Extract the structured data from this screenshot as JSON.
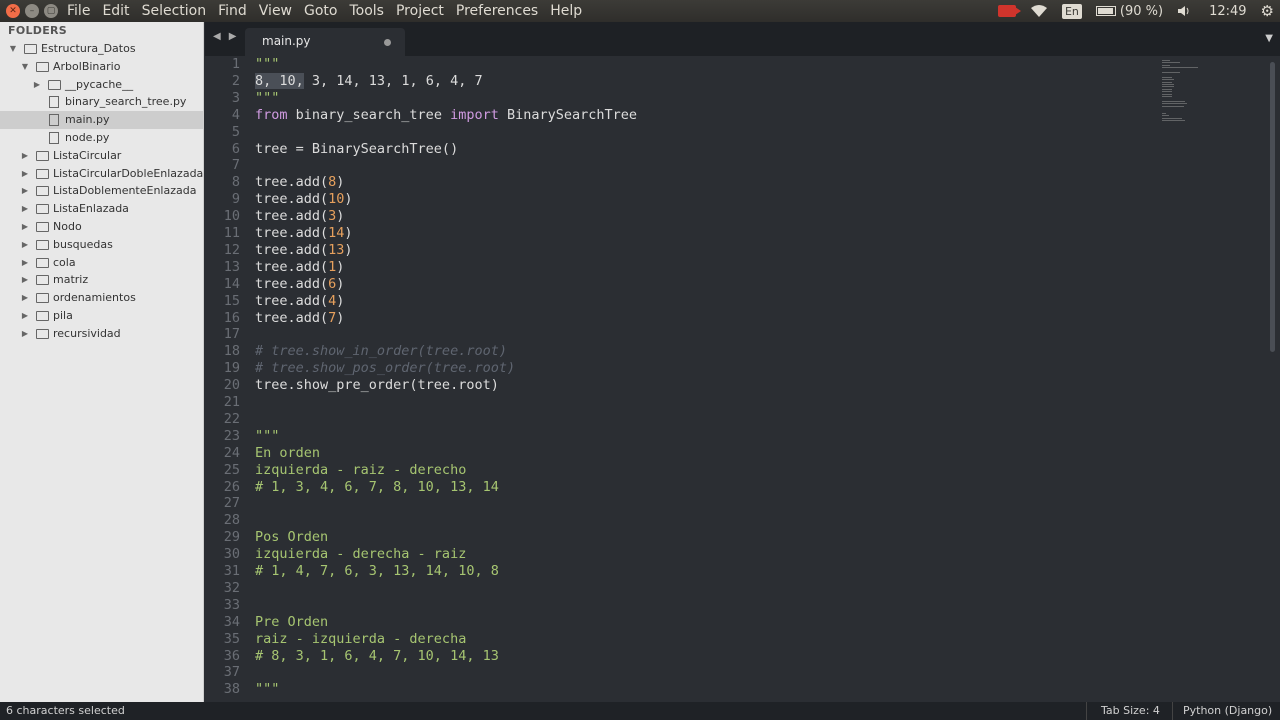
{
  "menubar": {
    "menus": [
      "File",
      "Edit",
      "Selection",
      "Find",
      "View",
      "Goto",
      "Tools",
      "Project",
      "Preferences",
      "Help"
    ],
    "keyboard_layout": "En",
    "battery": "(90 %)",
    "clock": "12:49"
  },
  "sidebar": {
    "title": "FOLDERS",
    "items": [
      {
        "label": "Estructura_Datos",
        "type": "folder",
        "level": 0,
        "expanded": true,
        "selected": false
      },
      {
        "label": "ArbolBinario",
        "type": "folder",
        "level": 1,
        "expanded": true,
        "selected": false
      },
      {
        "label": "__pycache__",
        "type": "folder",
        "level": 2,
        "expanded": false,
        "selected": false
      },
      {
        "label": "binary_search_tree.py",
        "type": "file",
        "level": 2,
        "selected": false
      },
      {
        "label": "main.py",
        "type": "file",
        "level": 2,
        "selected": true
      },
      {
        "label": "node.py",
        "type": "file",
        "level": 2,
        "selected": false
      },
      {
        "label": "ListaCircular",
        "type": "folder",
        "level": 1,
        "expanded": false,
        "selected": false
      },
      {
        "label": "ListaCircularDobleEnlazada",
        "type": "folder",
        "level": 1,
        "expanded": false,
        "selected": false
      },
      {
        "label": "ListaDoblementeEnlazada",
        "type": "folder",
        "level": 1,
        "expanded": false,
        "selected": false
      },
      {
        "label": "ListaEnlazada",
        "type": "folder",
        "level": 1,
        "expanded": false,
        "selected": false
      },
      {
        "label": "Nodo",
        "type": "folder",
        "level": 1,
        "expanded": false,
        "selected": false
      },
      {
        "label": "busquedas",
        "type": "folder",
        "level": 1,
        "expanded": false,
        "selected": false
      },
      {
        "label": "cola",
        "type": "folder",
        "level": 1,
        "expanded": false,
        "selected": false
      },
      {
        "label": "matriz",
        "type": "folder",
        "level": 1,
        "expanded": false,
        "selected": false
      },
      {
        "label": "ordenamientos",
        "type": "folder",
        "level": 1,
        "expanded": false,
        "selected": false
      },
      {
        "label": "pila",
        "type": "folder",
        "level": 1,
        "expanded": false,
        "selected": false
      },
      {
        "label": "recursividad",
        "type": "folder",
        "level": 1,
        "expanded": false,
        "selected": false
      }
    ]
  },
  "tabs": [
    {
      "label": "main.py",
      "active": true,
      "modified": true
    }
  ],
  "editor": {
    "lines": [
      {
        "n": "1",
        "tokens": [
          [
            "str",
            "\"\"\""
          ]
        ]
      },
      {
        "n": "2",
        "tokens": [
          [
            "sel",
            "8, 10,"
          ],
          [
            "plain",
            " 3, 14, 13, 1, 6, 4, 7"
          ]
        ]
      },
      {
        "n": "3",
        "tokens": [
          [
            "str",
            "\"\"\""
          ]
        ]
      },
      {
        "n": "4",
        "tokens": [
          [
            "kw",
            "from"
          ],
          [
            "plain",
            " binary_search_tree "
          ],
          [
            "kw",
            "import"
          ],
          [
            "plain",
            " BinarySearchTree"
          ]
        ]
      },
      {
        "n": "5",
        "tokens": []
      },
      {
        "n": "6",
        "tokens": [
          [
            "plain",
            "tree = BinarySearchTree()"
          ]
        ]
      },
      {
        "n": "7",
        "tokens": []
      },
      {
        "n": "8",
        "tokens": [
          [
            "plain",
            "tree.add("
          ],
          [
            "num",
            "8"
          ],
          [
            "plain",
            ")"
          ]
        ]
      },
      {
        "n": "9",
        "tokens": [
          [
            "plain",
            "tree.add("
          ],
          [
            "num",
            "10"
          ],
          [
            "plain",
            ")"
          ]
        ]
      },
      {
        "n": "10",
        "tokens": [
          [
            "plain",
            "tree.add("
          ],
          [
            "num",
            "3"
          ],
          [
            "plain",
            ")"
          ]
        ]
      },
      {
        "n": "11",
        "tokens": [
          [
            "plain",
            "tree.add("
          ],
          [
            "num",
            "14"
          ],
          [
            "plain",
            ")"
          ]
        ]
      },
      {
        "n": "12",
        "tokens": [
          [
            "plain",
            "tree.add("
          ],
          [
            "num",
            "13"
          ],
          [
            "plain",
            ")"
          ]
        ]
      },
      {
        "n": "13",
        "tokens": [
          [
            "plain",
            "tree.add("
          ],
          [
            "num",
            "1"
          ],
          [
            "plain",
            ")"
          ]
        ]
      },
      {
        "n": "14",
        "tokens": [
          [
            "plain",
            "tree.add("
          ],
          [
            "num",
            "6"
          ],
          [
            "plain",
            ")"
          ]
        ]
      },
      {
        "n": "15",
        "tokens": [
          [
            "plain",
            "tree.add("
          ],
          [
            "num",
            "4"
          ],
          [
            "plain",
            ")"
          ]
        ]
      },
      {
        "n": "16",
        "tokens": [
          [
            "plain",
            "tree.add("
          ],
          [
            "num",
            "7"
          ],
          [
            "plain",
            ")"
          ]
        ]
      },
      {
        "n": "17",
        "tokens": []
      },
      {
        "n": "18",
        "tokens": [
          [
            "cm",
            "# tree.show_in_order(tree.root)"
          ]
        ]
      },
      {
        "n": "19",
        "tokens": [
          [
            "cm",
            "# tree.show_pos_order(tree.root)"
          ]
        ]
      },
      {
        "n": "20",
        "tokens": [
          [
            "plain",
            "tree.show_pre_order(tree.root)"
          ]
        ]
      },
      {
        "n": "21",
        "tokens": []
      },
      {
        "n": "22",
        "tokens": []
      },
      {
        "n": "23",
        "tokens": [
          [
            "str",
            "\"\"\""
          ]
        ]
      },
      {
        "n": "24",
        "tokens": [
          [
            "str",
            "En orden"
          ]
        ]
      },
      {
        "n": "25",
        "tokens": [
          [
            "str",
            "izquierda - raiz - derecho"
          ]
        ]
      },
      {
        "n": "26",
        "tokens": [
          [
            "str",
            "# 1, 3, 4, 6, 7, 8, 10, 13, 14"
          ]
        ]
      },
      {
        "n": "27",
        "tokens": []
      },
      {
        "n": "28",
        "tokens": []
      },
      {
        "n": "29",
        "tokens": [
          [
            "str",
            "Pos Orden"
          ]
        ]
      },
      {
        "n": "30",
        "tokens": [
          [
            "str",
            "izquierda - derecha - raiz"
          ]
        ]
      },
      {
        "n": "31",
        "tokens": [
          [
            "str",
            "# 1, 4, 7, 6, 3, 13, 14, 10, 8"
          ]
        ]
      },
      {
        "n": "32",
        "tokens": []
      },
      {
        "n": "33",
        "tokens": []
      },
      {
        "n": "34",
        "tokens": [
          [
            "str",
            "Pre Orden"
          ]
        ]
      },
      {
        "n": "35",
        "tokens": [
          [
            "str",
            "raiz - izquierda - derecha"
          ]
        ]
      },
      {
        "n": "36",
        "tokens": [
          [
            "str",
            "# 8, 3, 1, 6, 4, 7, 10, 14, 13"
          ]
        ]
      },
      {
        "n": "37",
        "tokens": []
      },
      {
        "n": "38",
        "tokens": [
          [
            "str",
            "\"\"\""
          ]
        ]
      }
    ]
  },
  "statusbar": {
    "left": "6 characters selected",
    "tab_size": "Tab Size: 4",
    "syntax": "Python (Django)"
  },
  "colors": {
    "editor_bg": "#2b2e33",
    "string": "#a6c571",
    "keyword": "#d09be1",
    "number": "#e6a05d",
    "comment": "#5f6570"
  }
}
